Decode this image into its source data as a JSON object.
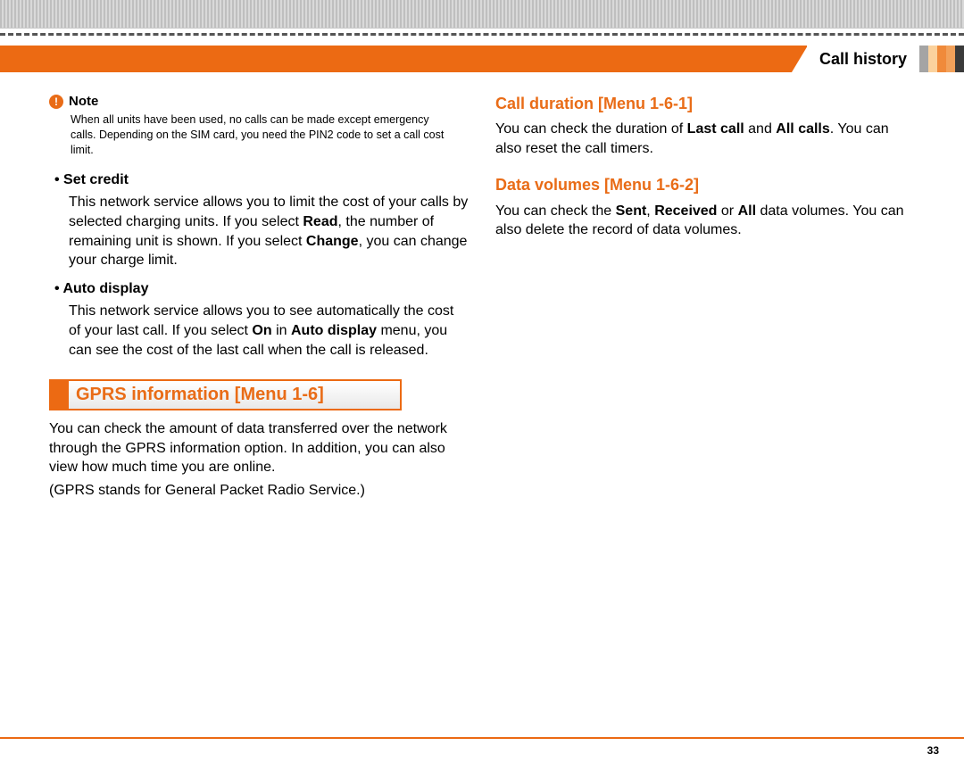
{
  "header": {
    "section_title": "Call history"
  },
  "left": {
    "note_label": "Note",
    "note_text": "When all units have been used, no calls can be made except emergency calls. Depending on the SIM card, you need the PIN2 code to set a call cost limit.",
    "set_credit_label": "• Set credit",
    "set_credit_p1a": "This network service allows you to limit the cost of your calls by selected charging units. If you select ",
    "set_credit_read": "Read",
    "set_credit_p1b": ", the number of remaining unit is shown. If you select ",
    "set_credit_change": "Change",
    "set_credit_p1c": ", you can change your charge limit.",
    "auto_display_label": "• Auto display",
    "auto_display_p1a": "This network service allows you to see automatically the cost of your last call. If you select ",
    "auto_display_on": "On",
    "auto_display_p1b": " in ",
    "auto_display_menu": "Auto display",
    "auto_display_p1c": " menu, you can see the cost of the last call when the call is released.",
    "gprs_title": "GPRS information [Menu 1-6]",
    "gprs_p1": "You can check the amount of data transferred over the network through the GPRS information option. In addition, you can also view how much time you are online.",
    "gprs_p2": "(GPRS stands for General Packet Radio Service.)"
  },
  "right": {
    "call_duration_title": "Call duration [Menu 1-6-1]",
    "call_duration_p1a": "You can check the duration of ",
    "call_duration_last": "Last call",
    "call_duration_p1b": " and ",
    "call_duration_all": "All calls",
    "call_duration_p1c": ". You can also reset the call timers.",
    "data_volumes_title": "Data volumes [Menu 1-6-2]",
    "data_volumes_p1a": "You can check the ",
    "data_volumes_sent": "Sent",
    "data_volumes_p1b": ", ",
    "data_volumes_received": "Received",
    "data_volumes_p1c": " or ",
    "data_volumes_all": "All",
    "data_volumes_p1d": " data volumes. You can also delete the record of data volumes."
  },
  "page_number": "33"
}
